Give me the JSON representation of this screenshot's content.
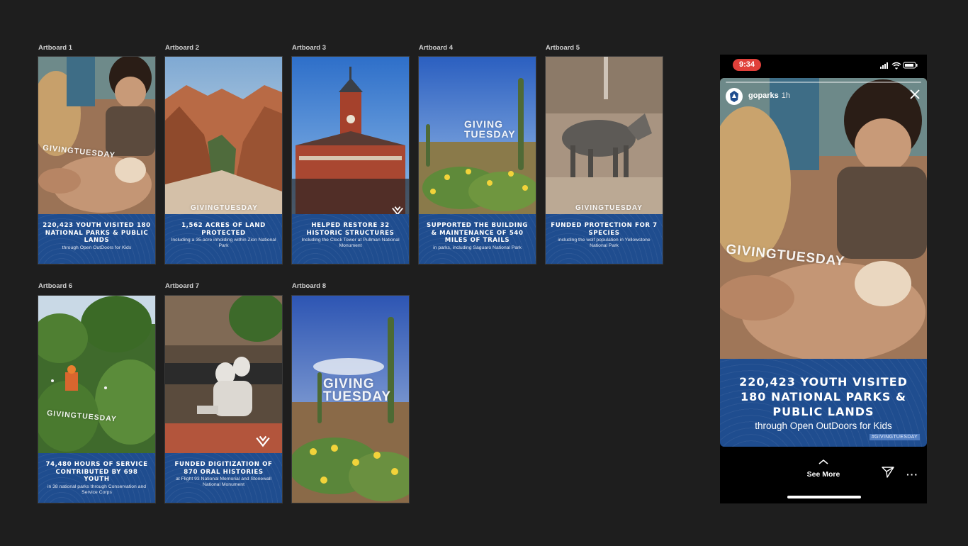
{
  "artboards": [
    {
      "label": "Artboard 1",
      "headline": "220,423 YOUTH VISITED 180 NATIONAL PARKS & PUBLIC LANDS",
      "subline": "through Open OutDoors for Kids"
    },
    {
      "label": "Artboard 2",
      "headline": "1,562 ACRES OF LAND PROTECTED",
      "subline": "Including a 35-acre inholding within Zion National Park"
    },
    {
      "label": "Artboard 3",
      "headline": "HELPED RESTORE 32 HISTORIC STRUCTURES",
      "subline": "Including the Clock Tower at Pullman National Monument"
    },
    {
      "label": "Artboard 4",
      "headline": "SUPPORTED THE BUILDING & MAINTENANCE OF 540 MILES OF TRAILS",
      "subline": "in parks, including Saguaro National Park"
    },
    {
      "label": "Artboard 5",
      "headline": "FUNDED PROTECTION FOR 7 SPECIES",
      "subline": "including the wolf population in Yellowstone National Park"
    },
    {
      "label": "Artboard 6",
      "headline": "74,480 HOURS OF SERVICE CONTRIBUTED BY 698 YOUTH",
      "subline": "in 38 national parks through Conservation and Service Corps"
    },
    {
      "label": "Artboard 7",
      "headline": "FUNDED DIGITIZATION OF 870 ORAL HISTORIES",
      "subline": "at Flight 93 National Memorial and Stonewall National Monument"
    },
    {
      "label": "Artboard 8",
      "headline": "",
      "subline": ""
    }
  ],
  "brand": {
    "giving_tuesday": "GIVINGTUESDAY",
    "giving_top": "GIVING",
    "giving_bottom": "TUESDAY"
  },
  "phone": {
    "time": "9:34",
    "account": "goparks",
    "posted": "1h",
    "headline_lines": [
      "220,423 YOUTH VISITED",
      "180 NATIONAL PARKS &",
      "PUBLIC LANDS"
    ],
    "subline": "through Open OutDoors for Kids",
    "hashtag": "#GIVINGTUESDAY",
    "see_more": "See More",
    "more": "···"
  },
  "colors": {
    "panel_blue": "#1f4d8f",
    "canvas": "#1e1e1e",
    "status_red": "#e0403a"
  }
}
